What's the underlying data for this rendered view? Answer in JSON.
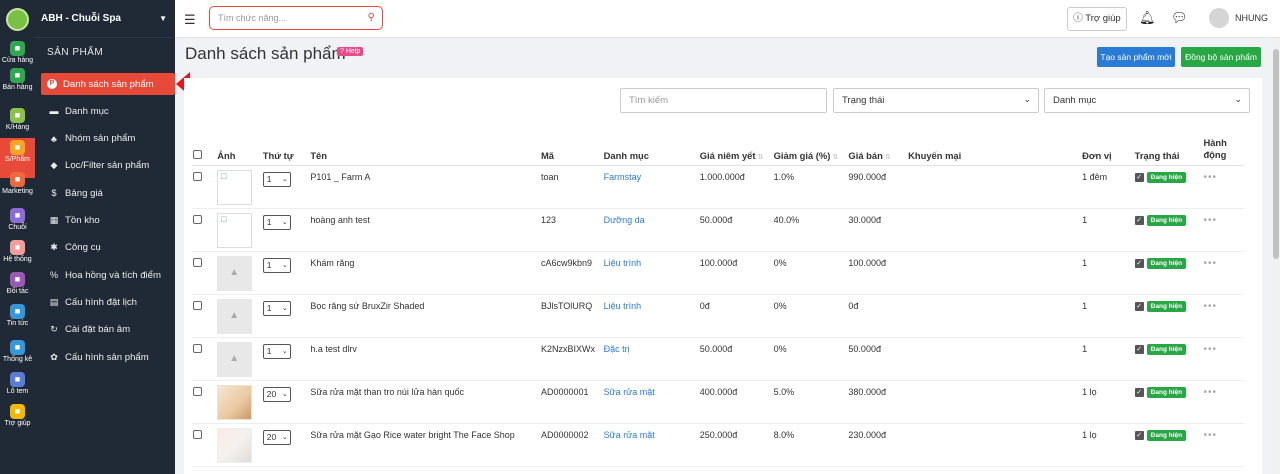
{
  "sidebar": {
    "brand": "ABH - Chuỗi Spa",
    "section_title": "SẢN PHẨM",
    "rail": [
      {
        "label": "Cửa hàng",
        "icon": "store-icon",
        "color": "#2fa84f"
      },
      {
        "label": "Bán hàng",
        "icon": "cart-icon",
        "color": "#2fa84f"
      },
      {
        "label": "K/Hàng",
        "icon": "customer-icon",
        "color": "#8bc34a"
      },
      {
        "label": "S/Phẩm",
        "icon": "product-icon",
        "color": "#f5a623"
      },
      {
        "label": "Marketing",
        "icon": "tag-icon",
        "color": "#f0683a"
      },
      {
        "label": "Chuỗi",
        "icon": "chain-icon",
        "color": "#8e6bd6"
      },
      {
        "label": "Hệ thống",
        "icon": "system-icon",
        "color": "#f39c9c"
      },
      {
        "label": "Đối tác",
        "icon": "partner-icon",
        "color": "#9b59b6"
      },
      {
        "label": "Tin tức",
        "icon": "news-icon",
        "color": "#3498db"
      },
      {
        "label": "Thống kê",
        "icon": "stats-icon",
        "color": "#3498db"
      },
      {
        "label": "Lô tem",
        "icon": "barcode-icon",
        "color": "#5a7bd6"
      },
      {
        "label": "Trợ giúp",
        "icon": "help-icon",
        "color": "#f5b800"
      }
    ],
    "items": [
      {
        "label": "Danh sách sản phẩm",
        "icon": "product-list-icon",
        "glyph": "P"
      },
      {
        "label": "Danh mục",
        "icon": "folder-icon",
        "glyph": "▬"
      },
      {
        "label": "Nhóm sản phẩm",
        "icon": "group-icon",
        "glyph": "♣"
      },
      {
        "label": "Lọc/Filter sản phẩm",
        "icon": "filter-icon",
        "glyph": "◆"
      },
      {
        "label": "Bảng giá",
        "icon": "dollar-icon",
        "glyph": "$"
      },
      {
        "label": "Tồn kho",
        "icon": "inventory-icon",
        "glyph": "▦"
      },
      {
        "label": "Công cụ",
        "icon": "tools-icon",
        "glyph": "✱"
      },
      {
        "label": "Hoa hồng và tích điểm",
        "icon": "percent-icon",
        "glyph": "%"
      },
      {
        "label": "Cấu hình đặt lịch",
        "icon": "calendar-icon",
        "glyph": "▤"
      },
      {
        "label": "Cài đặt bán âm",
        "icon": "sync-icon",
        "glyph": "↻"
      },
      {
        "label": "Cấu hình sản phẩm",
        "icon": "gear-icon",
        "glyph": "✿"
      }
    ]
  },
  "topbar": {
    "search_placeholder": "Tìm chức năng...",
    "help_label": "Trợ giúp",
    "user_name": "NHUNG"
  },
  "page": {
    "title": "Danh sách sản phẩm",
    "help_badge": "Help",
    "create_label": "Tạo sản phẩm mới",
    "sync_label": "Đồng bộ sản phẩm"
  },
  "filters": {
    "search_placeholder": "Tìm kiếm",
    "status_label": "Trạng thái",
    "category_label": "Danh mục"
  },
  "table": {
    "headers": {
      "image": "Ảnh",
      "order": "Thứ tự",
      "name": "Tên",
      "code": "Mã",
      "category": "Danh mục",
      "list_price": "Giá niêm yết",
      "discount": "Giảm giá (%)",
      "price": "Giá bán",
      "promo": "Khuyến mại",
      "unit": "Đơn vị",
      "status": "Trạng thái",
      "action": "Hành động"
    },
    "rows": [
      {
        "thumb": "broken",
        "order": "1",
        "name": "P101 _ Farm A",
        "code": "toan",
        "category": "Farmstay",
        "list_price": "1.000.000đ",
        "discount": "1.0%",
        "price": "990.000đ",
        "promo": "",
        "unit": "1 đêm",
        "status": "Đang hiện"
      },
      {
        "thumb": "broken",
        "order": "1",
        "name": "hoàng anh test",
        "code": "123",
        "category": "Dưỡng da",
        "list_price": "50.000đ",
        "discount": "40.0%",
        "price": "30.000đ",
        "promo": "",
        "unit": "1",
        "status": "Đang hiện"
      },
      {
        "thumb": "ph",
        "order": "1",
        "name": "Khám răng",
        "code": "cA6cw9kbn9",
        "category": "Liệu trình",
        "list_price": "100.000đ",
        "discount": "0%",
        "price": "100.000đ",
        "promo": "",
        "unit": "1",
        "status": "Đang hiện"
      },
      {
        "thumb": "ph",
        "order": "1",
        "name": "Bọc răng sứ BruxZir Shaded",
        "code": "BJlsTOlURQ",
        "category": "Liệu trình",
        "list_price": "0đ",
        "discount": "0%",
        "price": "0đ",
        "promo": "",
        "unit": "1",
        "status": "Đang hiện"
      },
      {
        "thumb": "ph",
        "order": "1",
        "name": "h.a test dlrv",
        "code": "K2NzxBIXWx",
        "category": "Đặc trị",
        "list_price": "50.000đ",
        "discount": "0%",
        "price": "50.000đ",
        "promo": "",
        "unit": "1",
        "status": "Đang hiện"
      },
      {
        "thumb": "photo1",
        "order": "20",
        "name": "Sữa rửa mặt than tro núi lửa hàn quốc",
        "code": "AD0000001",
        "category": "Sữa rửa mặt",
        "list_price": "400.000đ",
        "discount": "5.0%",
        "price": "380.000đ",
        "promo": "",
        "unit": "1 lọ",
        "status": "Đang hiện"
      },
      {
        "thumb": "photo2",
        "order": "20",
        "name": "Sữa rửa mặt Gạo Rice water bright The Face Shop",
        "code": "AD0000002",
        "category": "Sữa rửa mặt",
        "list_price": "250.000đ",
        "discount": "8.0%",
        "price": "230.000đ",
        "promo": "",
        "unit": "1 lọ",
        "status": "Đang hiện"
      }
    ]
  }
}
